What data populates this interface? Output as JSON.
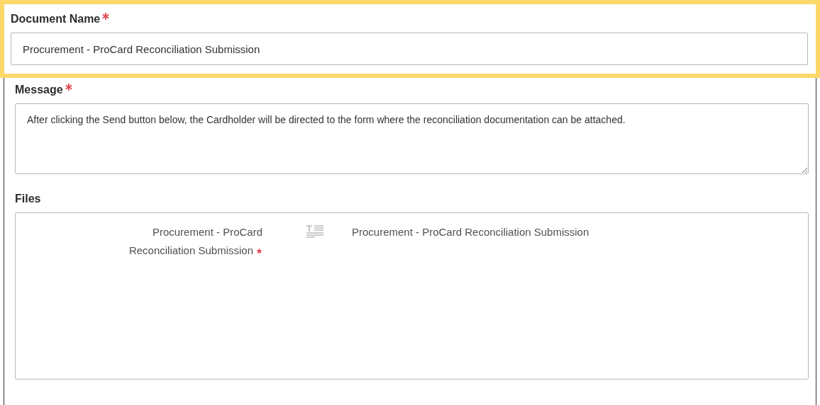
{
  "document_name": {
    "label": "Document Name",
    "required": true,
    "highlighted": true,
    "value": "Procurement - ProCard Reconciliation Submission"
  },
  "message": {
    "label": "Message",
    "required": true,
    "value": "After clicking the Send button below, the Cardholder will be directed to the form where the reconciliation documentation can be attached."
  },
  "files": {
    "label": "Files",
    "items": [
      {
        "name": "Procurement - ProCard Reconciliation Submission",
        "required": true,
        "file": "Procurement - ProCard Reconciliation Submission"
      }
    ]
  }
}
